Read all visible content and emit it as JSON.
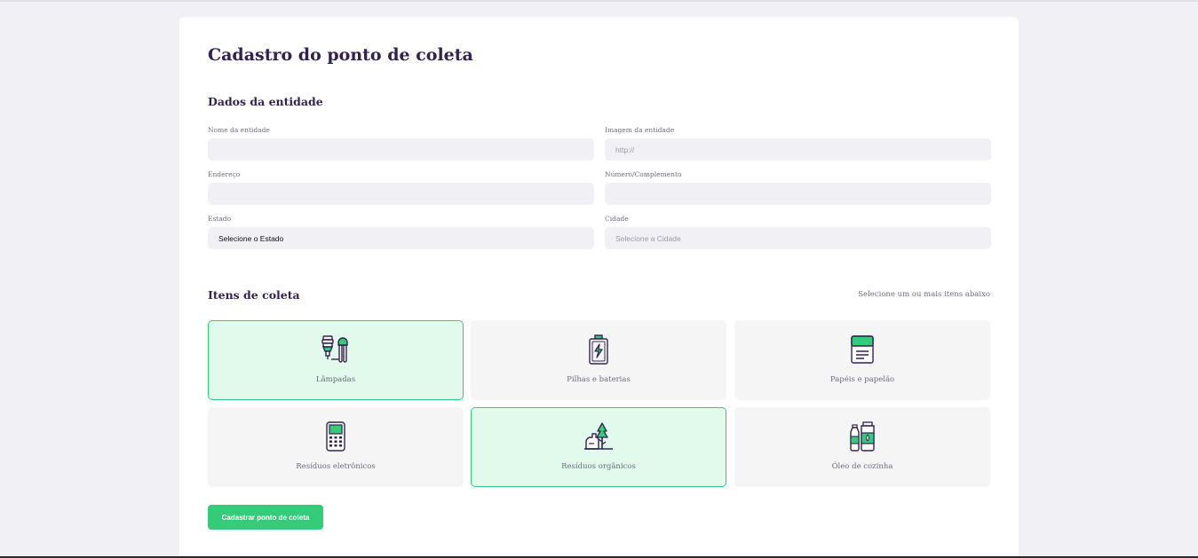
{
  "form": {
    "title": "Cadastro do ponto de coleta",
    "section_entity": "Dados da entidade",
    "fields": {
      "name": {
        "label": "Nome da entidade",
        "value": ""
      },
      "image": {
        "label": "Imagem da entidade",
        "placeholder": "http://"
      },
      "address": {
        "label": "Endereço",
        "value": ""
      },
      "number": {
        "label": "Número/Complemento",
        "value": ""
      },
      "state": {
        "label": "Estado",
        "value": "Selecione o Estado"
      },
      "city": {
        "label": "Cidade",
        "placeholder": "Selecione a Cidade"
      }
    },
    "section_items": "Itens de coleta",
    "items_hint": "Selecione um ou mais itens abaixo",
    "items": [
      {
        "label": "Lâmpadas",
        "icon": "lamps-icon",
        "selected": true
      },
      {
        "label": "Pilhas e baterias",
        "icon": "battery-icon",
        "selected": false
      },
      {
        "label": "Papéis e papelão",
        "icon": "paper-icon",
        "selected": false
      },
      {
        "label": "Resíduos eletrônicos",
        "icon": "electronics-icon",
        "selected": false
      },
      {
        "label": "Resíduos orgânicos",
        "icon": "organic-icon",
        "selected": true
      },
      {
        "label": "Óleo de cozinha",
        "icon": "cooking-oil-icon",
        "selected": false
      }
    ],
    "submit_label": "Cadastrar ponto de coleta"
  },
  "colors": {
    "accent": "#34cb79",
    "selected_bg": "#e1faec",
    "title": "#322153",
    "input_bg": "#f0f0f5"
  }
}
